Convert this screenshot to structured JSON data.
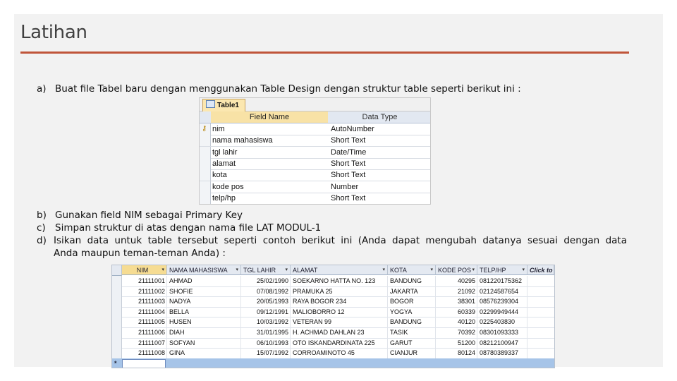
{
  "slide": {
    "title": "Latihan",
    "accent_color": "#c0553a"
  },
  "instructions": {
    "a": {
      "label": "a)",
      "text": "Buat file Tabel baru dengan menggunakan Table Design dengan struktur table seperti berikut ini :"
    },
    "b": {
      "label": "b)",
      "text": "Gunakan field NIM sebagai Primary Key"
    },
    "c": {
      "label": "c)",
      "text": "Simpan struktur di atas dengan nama file LAT MODUL-1"
    },
    "d": {
      "label": "d)",
      "text_line1": "Isikan data untuk table tersebut seperti contoh berikut ini (Anda dapat mengubah datanya sesuai dengan data",
      "text_line2": "Anda maupun teman-teman Anda) :"
    }
  },
  "design_table": {
    "tab_label": "Table1",
    "headers": {
      "field_name": "Field Name",
      "data_type": "Data Type"
    },
    "rows": [
      {
        "field": "nim",
        "type": "AutoNumber",
        "primary_key": true
      },
      {
        "field": "nama mahasiswa",
        "type": "Short Text"
      },
      {
        "field": "tgl lahir",
        "type": "Date/Time"
      },
      {
        "field": "alamat",
        "type": "Short Text"
      },
      {
        "field": "kota",
        "type": "Short Text"
      },
      {
        "field": "kode pos",
        "type": "Number"
      },
      {
        "field": "telp/hp",
        "type": "Short Text"
      }
    ]
  },
  "datasheet": {
    "columns": [
      "NIM",
      "NAMA MAHASISWA",
      "TGL LAHIR",
      "ALAMAT",
      "KOTA",
      "KODE POS",
      "TELP/HP",
      "Click to A"
    ],
    "rows": [
      [
        "21111001",
        "AHMAD",
        "25/02/1990",
        "SOEKARNO HATTA NO. 123",
        "BANDUNG",
        "40295",
        "081220175362"
      ],
      [
        "21111002",
        "SHOFIE",
        "07/08/1992",
        "PRAMUKA 25",
        "JAKARTA",
        "21092",
        "02124587654"
      ],
      [
        "21111003",
        "NADYA",
        "20/05/1993",
        "RAYA BOGOR 234",
        "BOGOR",
        "38301",
        "08576239304"
      ],
      [
        "21111004",
        "BELLA",
        "09/12/1991",
        "MALIOBORRO 12",
        "YOGYA",
        "60339",
        "02299949444"
      ],
      [
        "21111005",
        "HUSEN",
        "10/03/1992",
        "VETERAN 99",
        "BANDUNG",
        "40120",
        "0225403830"
      ],
      [
        "21111006",
        "DIAH",
        "31/01/1995",
        "H. ACHMAD DAHLAN 23",
        "TASIK",
        "70392",
        "08301093333"
      ],
      [
        "21111007",
        "SOFYAN",
        "06/10/1993",
        "OTO ISKANDARDINATA 225",
        "GARUT",
        "51200",
        "08212100947"
      ],
      [
        "21111008",
        "GINA",
        "15/07/1992",
        "CORROAMINOTO 45",
        "CIANJUR",
        "80124",
        "08780389337"
      ]
    ],
    "new_row_marker": "*"
  }
}
